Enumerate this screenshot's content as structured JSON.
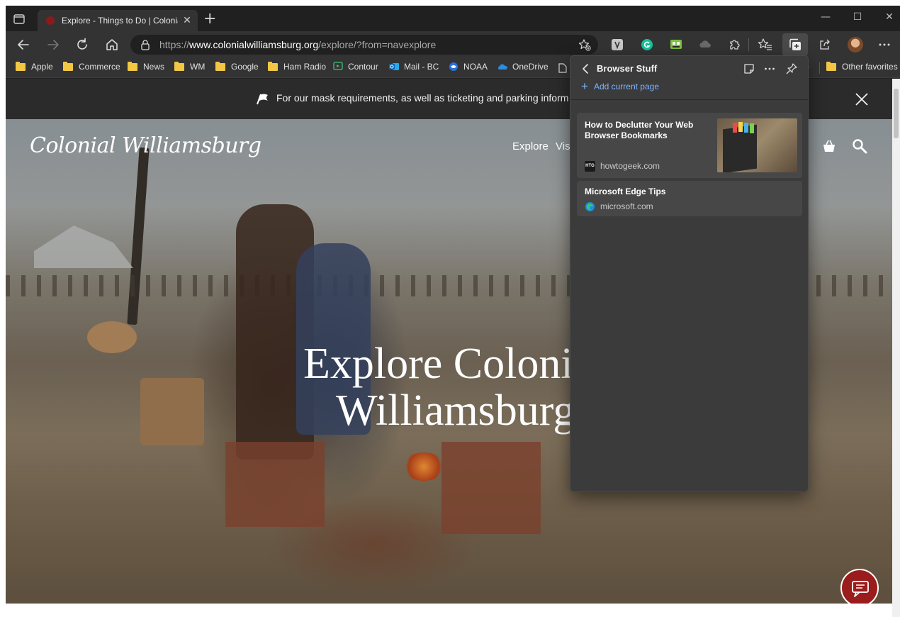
{
  "browser": {
    "tab": {
      "title": "Explore - Things to Do | Colonial",
      "close": "✕"
    },
    "new_tab": "+",
    "window_controls": {
      "minimize": "—",
      "maximize": "☐",
      "close": "✕"
    },
    "address": {
      "scheme": "https://",
      "host": "www.colonialwilliamsburg.org",
      "path": "/explore/?from=navexplore"
    },
    "toolbar_icons": [
      "back-icon",
      "forward-icon",
      "refresh-icon",
      "home-icon",
      "add-favorite-icon",
      "extension-icon",
      "grammarly-icon",
      "extension-green-icon",
      "cloud-icon",
      "extensions-puzzle-icon",
      "favorites-icon",
      "collections-icon",
      "share-icon",
      "profile-avatar",
      "more-icon"
    ]
  },
  "favorites": {
    "items": [
      {
        "label": "Apple",
        "icon": "folder"
      },
      {
        "label": "Commerce",
        "icon": "folder"
      },
      {
        "label": "News",
        "icon": "folder"
      },
      {
        "label": "WM",
        "icon": "folder"
      },
      {
        "label": "Google",
        "icon": "folder"
      },
      {
        "label": "Ham Radio",
        "icon": "folder"
      },
      {
        "label": "Contour",
        "icon": "contour"
      },
      {
        "label": "Mail - BC",
        "icon": "outlook"
      },
      {
        "label": "NOAA",
        "icon": "noaa"
      },
      {
        "label": "OneDrive",
        "icon": "onedrive"
      }
    ],
    "overflow": "›",
    "other": "Other favorites"
  },
  "page": {
    "banner": {
      "text": "For our mask requirements, as well as ticketing and parking inform"
    },
    "logo": "Colonial Williamsburg",
    "nav": {
      "explore": "Explore",
      "visit": "Vis"
    },
    "hero": {
      "line1": "Explore Coloni",
      "line2": "Williamsburg"
    }
  },
  "collections": {
    "title": "Browser Stuff",
    "add_current": "Add current page",
    "plus": "+",
    "items": [
      {
        "title": "How to Declutter Your Web Browser Bookmarks",
        "domain": "howtogeek.com",
        "favicon": "HTG"
      },
      {
        "title": "Microsoft Edge Tips",
        "domain": "microsoft.com"
      }
    ]
  },
  "colors": {
    "accent_link": "#7fb4ff",
    "chat_button": "#9b1c1c",
    "banner_bg": "#2b2b2b",
    "flyout_bg": "#3b3b3b"
  }
}
